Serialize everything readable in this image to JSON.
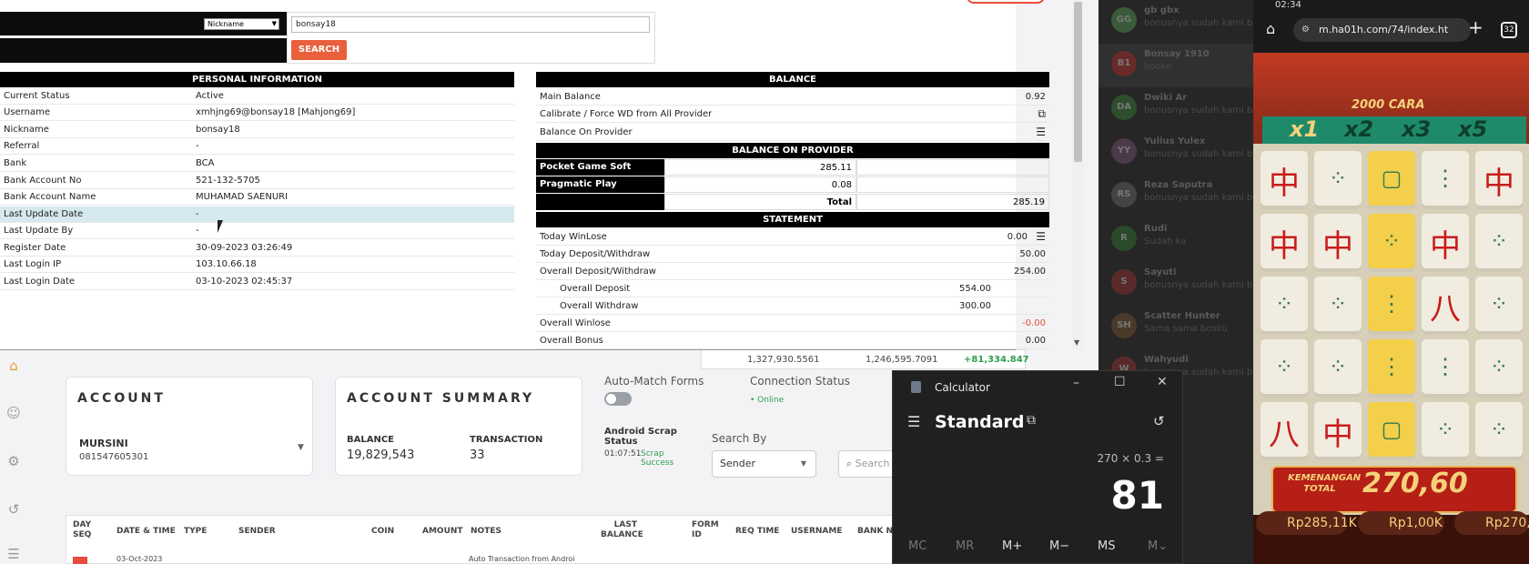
{
  "popup": {
    "search_by_select": "Nickname",
    "search_value": "bonsay18",
    "search_button": "SEARCH",
    "personal_title": "PERSONAL INFORMATION",
    "personal_rows": [
      {
        "k": "Current Status",
        "v": "Active"
      },
      {
        "k": "Username",
        "v": "xmhjng69@bonsay18  [Mahjong69]"
      },
      {
        "k": "Nickname",
        "v": "bonsay18"
      },
      {
        "k": "Referral",
        "v": "-"
      },
      {
        "k": "Bank",
        "v": "BCA"
      },
      {
        "k": "Bank Account No",
        "v": "521-132-5705"
      },
      {
        "k": "Bank Account Name",
        "v": "MUHAMAD SAENURI"
      },
      {
        "k": "Last Update Date",
        "v": "-"
      },
      {
        "k": "Last Update By",
        "v": "-"
      },
      {
        "k": "Register Date",
        "v": "30-09-2023 03:26:49"
      },
      {
        "k": "Last Login IP",
        "v": "103.10.66.18"
      },
      {
        "k": "Last Login Date",
        "v": "03-10-2023 02:45:37"
      }
    ],
    "balance_title": "BALANCE",
    "main_balance_label": "Main Balance",
    "main_balance": "0.92",
    "calibrate_label": "Calibrate / Force WD from All Provider",
    "balance_on_provider_label": "Balance On Provider",
    "provider_title": "BALANCE ON PROVIDER",
    "providers": [
      {
        "name": "Pocket Game Soft",
        "value": "285.11"
      },
      {
        "name": "Pragmatic Play",
        "value": "0.08"
      }
    ],
    "provider_total_label": "Total",
    "provider_total": "285.19",
    "statement_title": "STATEMENT",
    "statement": [
      {
        "k": "Today WinLose",
        "v": "0.00"
      },
      {
        "k": "Today Deposit/Withdraw",
        "v": "50.00"
      },
      {
        "k": "Overall Deposit/Withdraw",
        "v": "254.00"
      },
      {
        "k": "Overall Deposit",
        "v": "554.00"
      },
      {
        "k": "Overall Withdraw",
        "v": "300.00"
      },
      {
        "k": "Overall Winlose",
        "v": "-0.00"
      },
      {
        "k": "Overall Bonus",
        "v": "0.00"
      }
    ]
  },
  "admin": {
    "stats": [
      "1,327,930.5561",
      "1,246,595.7091",
      "+81,334.847"
    ],
    "account_title": "ACCOUNT",
    "account_name": "MURSINI",
    "account_phone": "081547605301",
    "summary_title": "ACCOUNT SUMMARY",
    "balance_label": "BALANCE",
    "balance_value": "19,829,543",
    "transaction_label": "TRANSACTION",
    "transaction_value": "33",
    "auto_match_label": "Auto-Match Forms",
    "connection_label": "Connection Status",
    "connection_value": "• Online",
    "scrap_label": "Android Scrap Status",
    "scrap_time": "01:07:51",
    "scrap_state": "Scrap Success",
    "search_by_label": "Search By",
    "search_by_value": "Sender",
    "search_placeholder": "Search",
    "columns": [
      "DAY SEQ",
      "DATE & TIME",
      "TYPE",
      "SENDER",
      "COIN",
      "AMOUNT",
      "NOTES",
      "LAST BALANCE",
      "FORM ID",
      "REQ TIME",
      "USERNAME",
      "BANK NA"
    ],
    "row_date": "03-Oct-2023",
    "row_note": "Auto Transaction from Androi"
  },
  "chat": [
    {
      "i": "GG",
      "n": "gb gbx",
      "m": "bonusnya sudah kami ber"
    },
    {
      "i": "B1",
      "n": "Bonsay 1910",
      "m": "booko"
    },
    {
      "i": "DA",
      "n": "Dwiki Ar",
      "m": "bonusnya sudah kami ber"
    },
    {
      "i": "YY",
      "n": "Yulius Yulex",
      "m": "bonusnya sudah kami ber"
    },
    {
      "i": "RS",
      "n": "Reza Saputra",
      "m": "bonusnya sudah kami ber"
    },
    {
      "i": "R",
      "n": "Rudi",
      "m": "Sudah ka"
    },
    {
      "i": "S",
      "n": "Sayuti",
      "m": "bonusnya sudah kami ber"
    },
    {
      "i": "SH",
      "n": "Scatter Hunter",
      "m": "Sama sama bosku"
    },
    {
      "i": "W",
      "n": "Wahyudi",
      "m": "bonusnya sudah kami ber"
    }
  ],
  "calculator": {
    "title": "Calculator",
    "mode": "Standard",
    "expression": "270 × 0.3 =",
    "result": "81",
    "memory_keys": [
      "MC",
      "MR",
      "M+",
      "M−",
      "MS",
      "M⌄"
    ]
  },
  "phone": {
    "time": "02:34",
    "url": "m.ha01h.com/74/index.ht",
    "tab_count": "32",
    "game_banner": "2000 CARA",
    "multipliers": [
      "x1",
      "x2",
      "x3",
      "x5"
    ],
    "win_label": "KEMENANGAN TOTAL",
    "win_amount": "270,60",
    "coins": [
      "Rp285,11K",
      "Rp1,00K",
      "Rp270,"
    ]
  },
  "colors": {
    "accent": "#e74c3c",
    "header_black": "#000000",
    "highlight_row": "#d6e9ef",
    "negative": "#e74c3c",
    "calc_bg": "#202020",
    "game_red": "#8a2b1c"
  }
}
